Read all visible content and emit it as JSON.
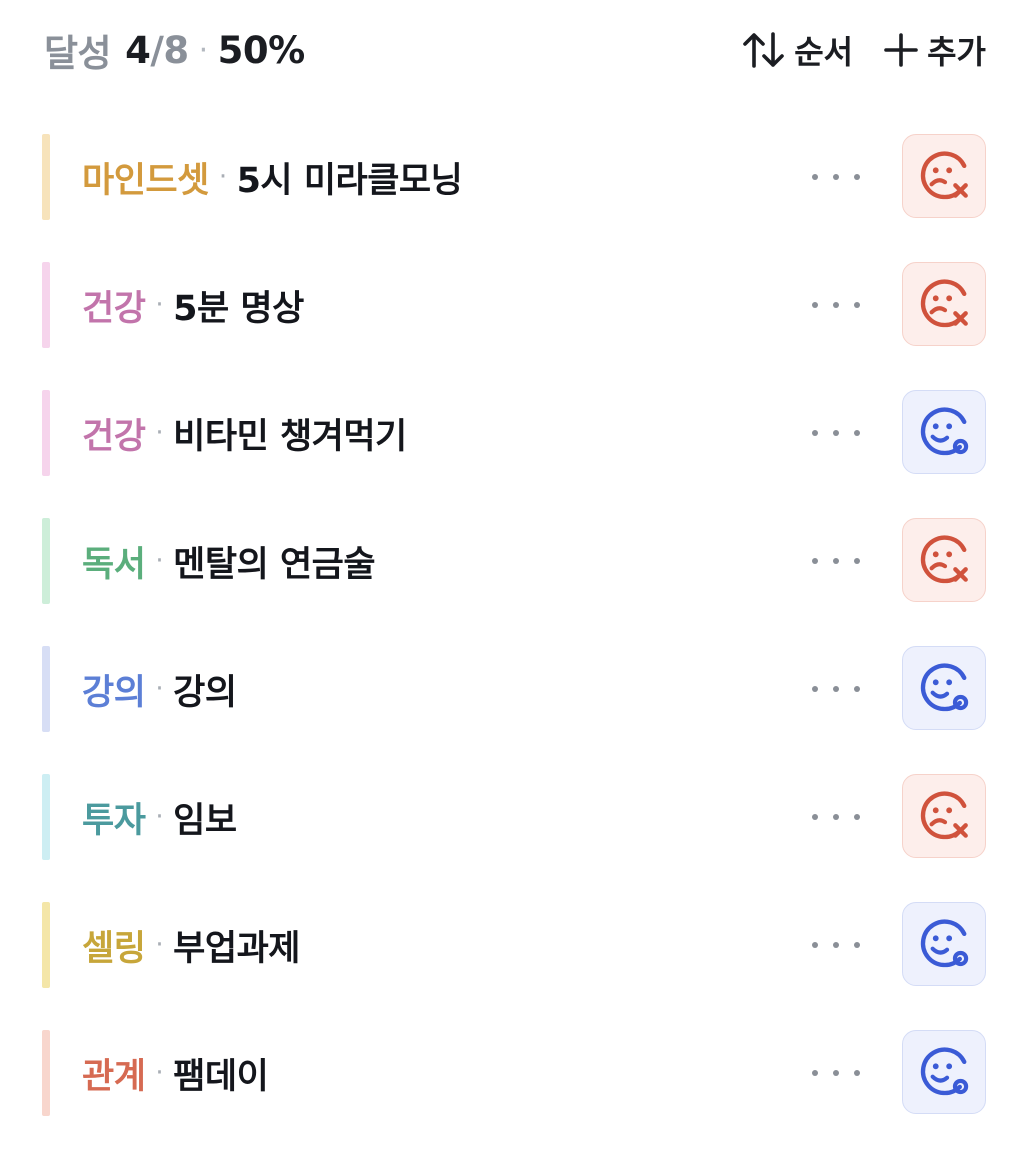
{
  "header": {
    "label": "달성",
    "done": "4",
    "slash": "/",
    "total": "8",
    "dot": "·",
    "percent": "50%",
    "sort_label": "순서",
    "add_label": "추가"
  },
  "colors": {
    "fail_icon": "#d0523c",
    "done_icon": "#3b5bd6"
  },
  "items": [
    {
      "category": "마인드셋",
      "sep": "·",
      "title": "5시 미라클모닝",
      "status": "fail",
      "status_icon": "sad-face-x-icon",
      "category_color": "#d39a3d",
      "bar_color": "#f7e3bb"
    },
    {
      "category": "건강",
      "sep": "·",
      "title": "5분 명상",
      "status": "fail",
      "status_icon": "sad-face-x-icon",
      "category_color": "#c274ab",
      "bar_color": "#f6d4ec"
    },
    {
      "category": "건강",
      "sep": "·",
      "title": "비타민 챙겨먹기",
      "status": "done",
      "status_icon": "smile-face-o-icon",
      "category_color": "#c274ab",
      "bar_color": "#f6d4ec"
    },
    {
      "category": "독서",
      "sep": "·",
      "title": "멘탈의 연금술",
      "status": "fail",
      "status_icon": "sad-face-x-icon",
      "category_color": "#5bae7c",
      "bar_color": "#cdeed9"
    },
    {
      "category": "강의",
      "sep": "·",
      "title": "강의",
      "status": "done",
      "status_icon": "smile-face-o-icon",
      "category_color": "#5c7fd6",
      "bar_color": "#d7def5"
    },
    {
      "category": "투자",
      "sep": "·",
      "title": "임보",
      "status": "fail",
      "status_icon": "sad-face-x-icon",
      "category_color": "#4b9a9e",
      "bar_color": "#cdeef3"
    },
    {
      "category": "셀링",
      "sep": "·",
      "title": "부업과제",
      "status": "done",
      "status_icon": "smile-face-o-icon",
      "category_color": "#c7a63a",
      "bar_color": "#f4e6a8"
    },
    {
      "category": "관계",
      "sep": "·",
      "title": "팸데이",
      "status": "done",
      "status_icon": "smile-face-o-icon",
      "category_color": "#d66a52",
      "bar_color": "#f8d6cd"
    }
  ]
}
